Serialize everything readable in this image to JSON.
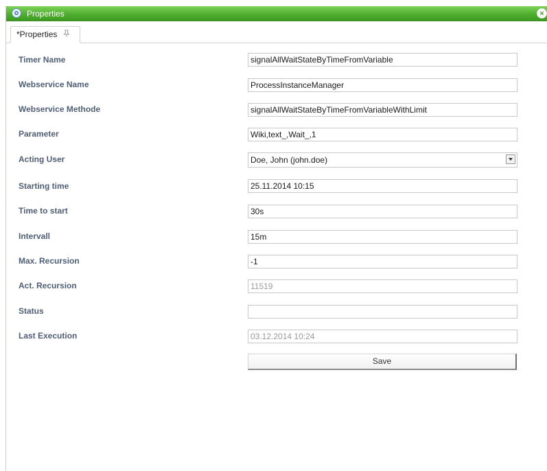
{
  "window": {
    "title": "Properties",
    "title_icon": "gear-icon",
    "close_icon": "close-icon",
    "close_glyph": "×"
  },
  "tabs": [
    {
      "label": "*Properties",
      "icon": "pin-icon"
    }
  ],
  "form": {
    "rows": [
      {
        "label": "Timer Name",
        "value": "signalAllWaitStateByTimeFromVariable",
        "type": "text"
      },
      {
        "label": "Webservice Name",
        "value": "ProcessInstanceManager",
        "type": "text"
      },
      {
        "label": "Webservice Methode",
        "value": "signalAllWaitStateByTimeFromVariableWithLimit",
        "type": "text"
      },
      {
        "label": "Parameter",
        "value": "Wiki,text_,Wait_,1",
        "type": "text"
      },
      {
        "label": "Acting User",
        "value": "Doe, John (john.doe)",
        "type": "select"
      },
      {
        "label": "Starting time",
        "value": "25.11.2014  10:15",
        "type": "text"
      },
      {
        "label": "Time to start",
        "value": "30s",
        "type": "text"
      },
      {
        "label": "Intervall",
        "value": "15m",
        "type": "text"
      },
      {
        "label": "Max. Recursion",
        "value": "-1",
        "type": "text"
      },
      {
        "label": "Act. Recursion",
        "value": "11519",
        "type": "readonly"
      },
      {
        "label": "Status",
        "value": "",
        "type": "text"
      },
      {
        "label": "Last Execution",
        "value": "03.12.2014  10:24",
        "type": "readonly"
      }
    ],
    "save_label": "Save"
  },
  "colors": {
    "titlebar": "#4fae2e",
    "label": "#4f5e76",
    "readonly_text": "#9a9a9a"
  }
}
